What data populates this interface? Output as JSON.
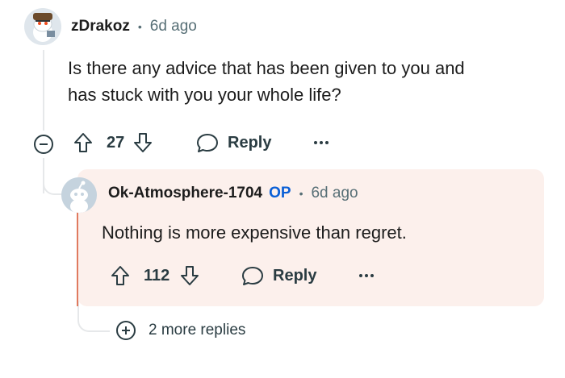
{
  "top_comment": {
    "username": "zDrakoz",
    "separator": "•",
    "time": "6d ago",
    "text_line1": "Is there any advice that has been given to you and",
    "text_line2": "has stuck with you your whole life?",
    "votes": "27",
    "reply_label": "Reply",
    "more_icon": "ellipsis-icon",
    "collapse_icon": "minus-circle-icon"
  },
  "reply_comment": {
    "username": "Ok-Atmosphere-1704",
    "op_badge": "OP",
    "separator": "•",
    "time": "6d ago",
    "text": "Nothing is more expensive than regret.",
    "votes": "112",
    "reply_label": "Reply",
    "more_icon": "ellipsis-icon"
  },
  "more_replies": {
    "label": "2 more replies",
    "icon": "plus-circle-icon"
  },
  "colors": {
    "reply_background": "#fcf0ec",
    "op_badge": "#0a5fd6",
    "thread_line": "#e6e8ea",
    "highlight_bar": "#e07a5f"
  }
}
